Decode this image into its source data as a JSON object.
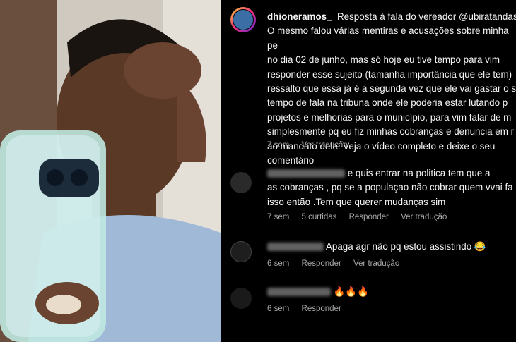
{
  "post": {
    "username": "dhioneramos_",
    "caption": "Resposta à fala do vereador @ubiratandas\nO mesmo falou várias mentiras e acusações sobre minha pe\nno dia 02 de junho, mas só hoje eu tive tempo para vim\nresponder esse sujeito (tamanha importância que ele tem) \nressalto que essa já é a segunda vez que ele vai gastar o s\ntempo de fala na tribuna onde ele poderia estar lutando p\nprojetos e melhorias para o município, para vim falar de m\nsimplesmente pq eu fiz minhas cobranças e denuncia em r\nao mandato dele. Veja o vídeo completo e deixe o seu\ncomentário",
    "time": "7 sem",
    "translate": "Ver tradução"
  },
  "comments": [
    {
      "text": "e quis entrar na politica tem que a\nas cobranças , pq se a populaçao não cobrar quem vvai fa\nisso então .Tem que querer mudanças sim",
      "time": "7 sem",
      "likes": "5 curtidas",
      "reply": "Responder",
      "translate": "Ver tradução"
    },
    {
      "text": "Apaga agr não pq estou assistindo 😂",
      "time": "6 sem",
      "reply": "Responder",
      "translate": "Ver tradução"
    },
    {
      "text": "🔥🔥🔥",
      "time": "6 sem",
      "reply": "Responder"
    }
  ]
}
